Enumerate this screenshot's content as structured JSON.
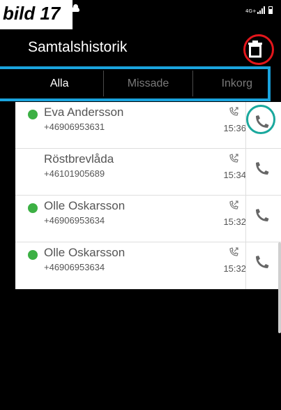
{
  "annotation": {
    "label": "bild 17"
  },
  "status_bar": {
    "network": "4G+"
  },
  "header": {
    "title": "Samtalshistorik",
    "trash_icon": "trash-icon"
  },
  "tabs": [
    {
      "label": "Alla",
      "active": true
    },
    {
      "label": "Missade",
      "active": false
    },
    {
      "label": "Inkorg",
      "active": false
    }
  ],
  "calls": [
    {
      "name": "Eva Andersson",
      "number": "+46906953631",
      "time": "15:36",
      "online": true
    },
    {
      "name": "Röstbrevlåda",
      "number": "+46101905689",
      "time": "15:34",
      "online": false
    },
    {
      "name": "Olle Oskarsson",
      "number": "+46906953634",
      "time": "15:32",
      "online": true
    },
    {
      "name": "Olle Oskarsson",
      "number": "+46906953634",
      "time": "15:32",
      "online": true
    }
  ],
  "colors": {
    "accent_red": "#e3161b",
    "accent_teal": "#1aa89d",
    "accent_blue": "#1aa3dd",
    "presence_green": "#3cb044"
  }
}
